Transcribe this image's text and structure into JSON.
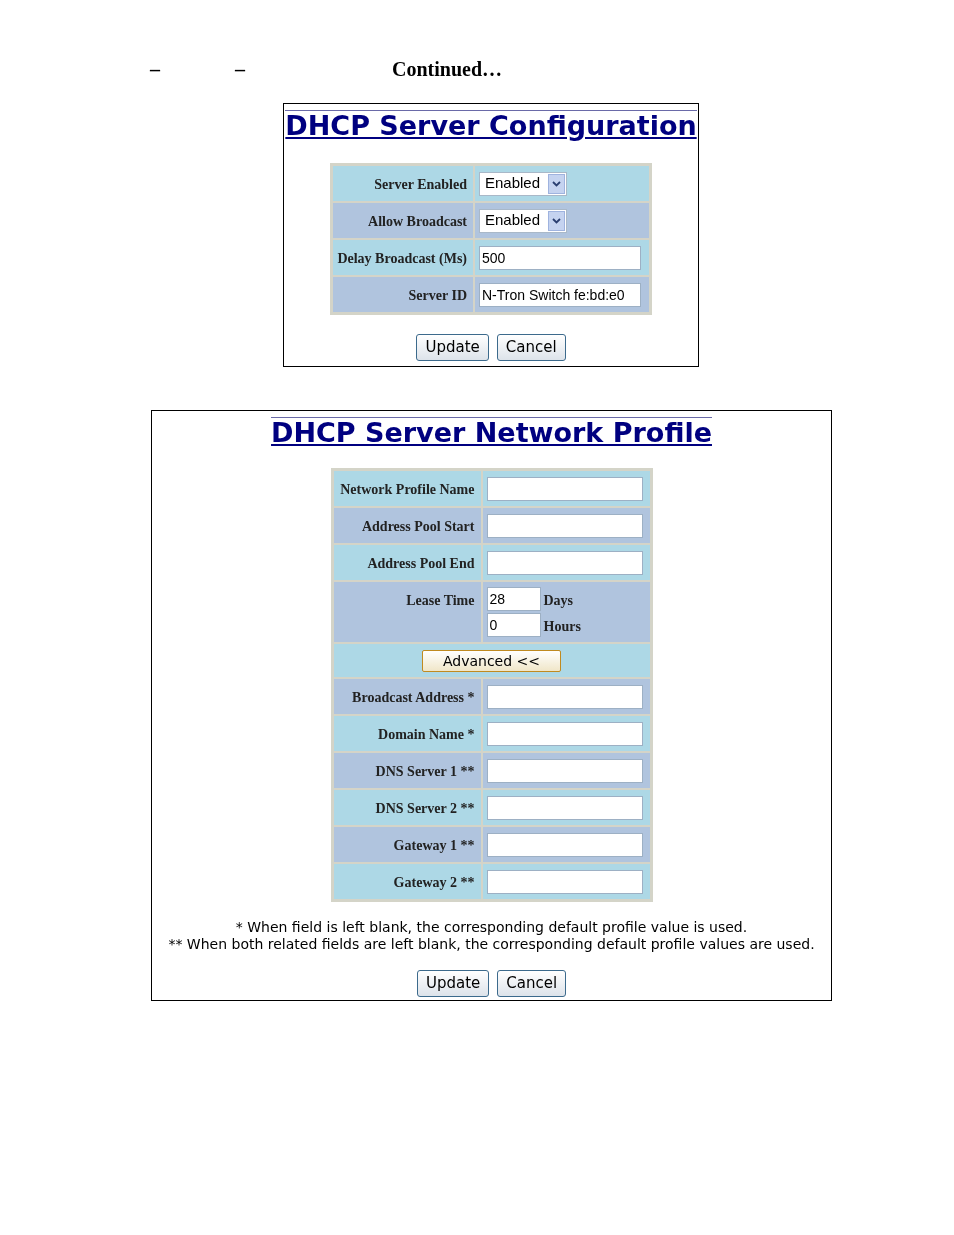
{
  "header": {
    "dash_1": "–",
    "dash_2": "–",
    "title": "Continued…"
  },
  "config_panel": {
    "title": "DHCP Server Configuration",
    "rows": [
      {
        "kind": "select",
        "label": "Server Enabled",
        "value": "Enabled"
      },
      {
        "kind": "select",
        "label": "Allow Broadcast",
        "value": "Enabled"
      },
      {
        "kind": "text",
        "label": "Delay Broadcast (Ms)",
        "value": "500"
      },
      {
        "kind": "text",
        "label": "Server ID",
        "value": "N-Tron Switch fe:bd:e0"
      }
    ],
    "buttons": [
      "Update",
      "Cancel"
    ]
  },
  "profile_panel": {
    "title": "DHCP Server Network Profile",
    "rows": [
      {
        "kind": "text",
        "label": "Network Profile Name"
      },
      {
        "kind": "text",
        "label": "Address Pool Start"
      },
      {
        "kind": "text",
        "label": "Address Pool End"
      },
      {
        "kind": "lease",
        "label": "Lease Time",
        "fields": [
          {
            "value": "28",
            "unit": "Days"
          },
          {
            "value": "0",
            "unit": "Hours"
          }
        ]
      },
      {
        "kind": "button",
        "label": "Advanced <<"
      },
      {
        "kind": "text",
        "label": "Broadcast Address *"
      },
      {
        "kind": "text",
        "label": "Domain Name *"
      },
      {
        "kind": "text",
        "label": "DNS Server 1 **"
      },
      {
        "kind": "text",
        "label": "DNS Server 2 **"
      },
      {
        "kind": "text",
        "label": "Gateway 1 **"
      },
      {
        "kind": "text",
        "label": "Gateway 2 **"
      }
    ],
    "notes": [
      "* When field is left blank, the corresponding default profile value is used.",
      "** When both related fields are left blank, the corresponding default profile values are used."
    ],
    "buttons": [
      "Update",
      "Cancel"
    ]
  }
}
